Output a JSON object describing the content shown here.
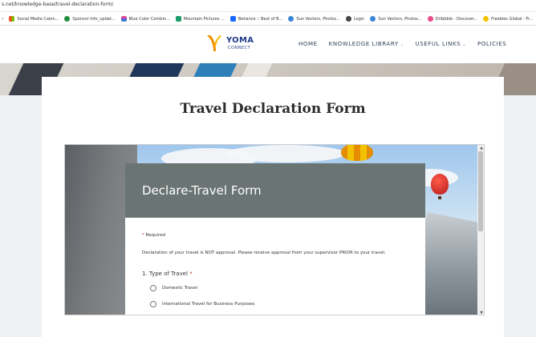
{
  "browser": {
    "url": "s.net/knowledge-base/travel-declaration-form/",
    "bookmarks": [
      {
        "label": "Social Media Calen...",
        "color": "#f4a300"
      },
      {
        "label": "Sponsor Info_updat...",
        "color": "#1e8e3e"
      },
      {
        "label": "Blue Color Combin...",
        "color": "#7b4bd6"
      },
      {
        "label": "Mountain Pictures ...",
        "color": "#1a9c6a"
      },
      {
        "label": "Behance :: Best of B...",
        "color": "#1769ff"
      },
      {
        "label": "Sun Vectors, Photos...",
        "color": "#3a87d6"
      },
      {
        "label": "Login",
        "color": "#444444"
      },
      {
        "label": "Sun Vectors, Photos...",
        "color": "#3a87d6"
      },
      {
        "label": "Dribbble - Discover...",
        "color": "#ea4c89"
      },
      {
        "label": "Freebies Global - Fr...",
        "color": "#f2c200"
      }
    ]
  },
  "header": {
    "logo": {
      "brand": "YOMA",
      "sub": "CONNECT"
    },
    "nav": [
      {
        "label": "HOME",
        "has_dropdown": false
      },
      {
        "label": "KNOWLEDGE LIBRARY",
        "has_dropdown": true
      },
      {
        "label": "USEFUL LINKS",
        "has_dropdown": true
      },
      {
        "label": "POLICIES",
        "has_dropdown": false
      }
    ]
  },
  "page": {
    "title": "Travel Declaration Form"
  },
  "form": {
    "title": "Declare-Travel Form",
    "required_label": "Required",
    "declaration": "Declaration of your travel is NOT approval. Please receive approval from your supervisor PRIOR to your travel.",
    "question1": {
      "label": "1. Type of Travel",
      "options": [
        "Domestic Travel",
        "International Travel for Business Purposes"
      ]
    }
  },
  "colors": {
    "accent_blue": "#1f3c88",
    "form_header": "#6a7473",
    "required_star": "#c0392b"
  }
}
